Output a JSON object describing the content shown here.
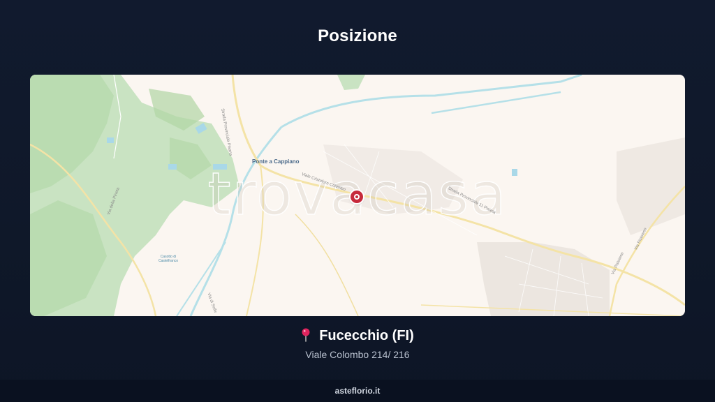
{
  "page": {
    "title": "Posizione"
  },
  "map": {
    "watermark": "trovacasa",
    "place_name": "Ponte a Cappiano",
    "labels": {
      "via_provinciale_pisana": "Strada Provinciale Pisana",
      "viale_colombo": "Viale Cristoforo Colombo",
      "sp11": "Strada Provinciale 11 Pisana",
      "via_della_pineta": "Via della Pineta",
      "via_di_selle": "Via di Selle",
      "via_pistoiese": "Via Pistoiese",
      "via_pistoiese_2": "Via Pistoiese",
      "casotto": "Casotto di Castelfranco"
    },
    "colors": {
      "background": "#fbf6f1",
      "green": "#c8e3c4",
      "river": "#b5e0e8",
      "road": "#f4e3a6",
      "marker": "#c62a3b"
    }
  },
  "location": {
    "pin_icon": "round-pushpin-icon",
    "city": "Fucecchio (FI)",
    "address": "Viale Colombo 214/ 216"
  },
  "footer": {
    "text": "asteflorio.it"
  }
}
